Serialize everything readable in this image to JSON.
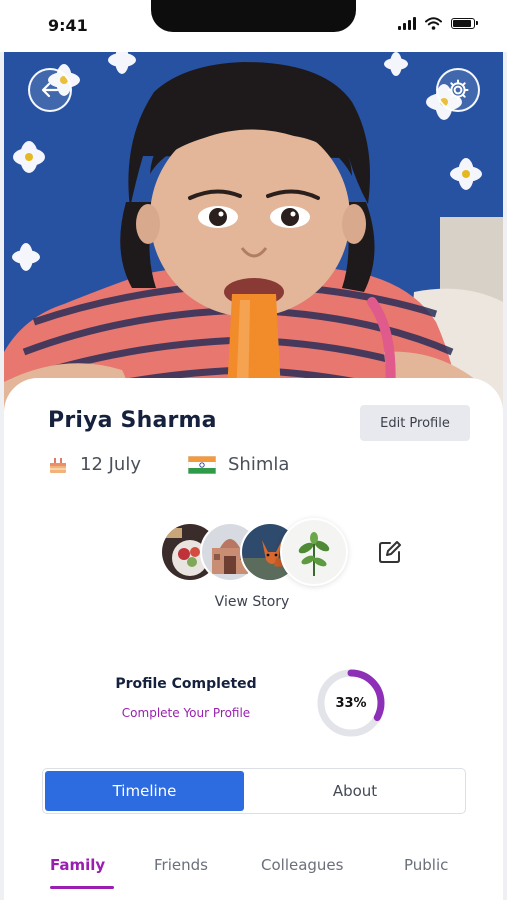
{
  "status_bar": {
    "time": "9:41",
    "icons": [
      "signal-icon",
      "wifi-icon",
      "battery-icon"
    ]
  },
  "header": {
    "back_icon": "back-arrow-icon",
    "settings_icon": "gear-icon"
  },
  "profile": {
    "name": "Priya Sharma",
    "edit_label": "Edit Profile",
    "birthday": "12 July",
    "location": "Shimla",
    "birthday_icon": "cake-icon",
    "location_icon": "india-flag-icon"
  },
  "stories": {
    "label": "View Story",
    "thumbnails": [
      "story-food",
      "story-monument",
      "story-fox",
      "story-plant"
    ],
    "edit_icon": "pencil-edit-icon"
  },
  "completion": {
    "title": "Profile Completed",
    "link": "Complete Your Profile",
    "percent_label": "33%",
    "percent": 33
  },
  "tabs": [
    {
      "label": "Timeline",
      "active": true
    },
    {
      "label": "About",
      "active": false
    }
  ],
  "subtabs": [
    {
      "label": "Family",
      "active": true
    },
    {
      "label": "Friends",
      "active": false
    },
    {
      "label": "Colleagues",
      "active": false
    },
    {
      "label": "Public",
      "active": false
    }
  ],
  "colors": {
    "accent": "#2d6be0",
    "purple": "#9a1fb0",
    "dark": "#16213e",
    "progress_track": "#e3e4ea"
  }
}
